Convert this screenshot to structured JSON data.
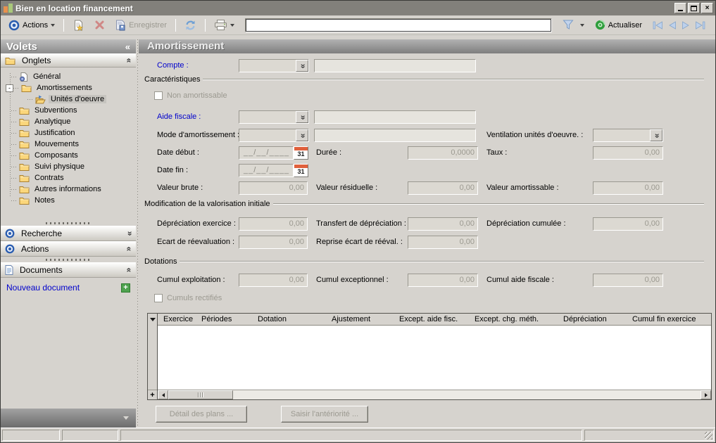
{
  "window": {
    "title": "Bien en location financement"
  },
  "glyphs": {
    "collapse_chevrons": "«",
    "close": "×",
    "plus": "+",
    "table_plus": "+"
  },
  "toolbar": {
    "actions_label": "Actions",
    "save_label": "Enregistrer",
    "refresh_label": "Actualiser",
    "search_value": ""
  },
  "sidebar": {
    "title": "Volets",
    "onglets_header": "Onglets",
    "tree": [
      {
        "label": "Général"
      },
      {
        "label": "Amortissements",
        "expander": "-"
      },
      {
        "label": "Unités d'oeuvre"
      },
      {
        "label": "Subventions"
      },
      {
        "label": "Analytique"
      },
      {
        "label": "Justification"
      },
      {
        "label": "Mouvements"
      },
      {
        "label": "Composants"
      },
      {
        "label": "Suivi physique"
      },
      {
        "label": "Contrats"
      },
      {
        "label": "Autres informations"
      },
      {
        "label": "Notes"
      }
    ],
    "recherche_header": "Recherche",
    "actions_header": "Actions",
    "documents_header": "Documents",
    "new_document_label": "Nouveau document"
  },
  "main": {
    "title": "Amortissement",
    "groups": {
      "caracteristiques": "Caractéristiques",
      "modification": "Modification de la valorisation initiale",
      "dotations": "Dotations"
    },
    "fields": {
      "compte": {
        "label": "Compte :",
        "value": ""
      },
      "non_amortissable": {
        "label": "Non amortissable"
      },
      "aide_fiscale": {
        "label": "Aide fiscale :",
        "value": ""
      },
      "mode_amortissement": {
        "label": "Mode d'amortissement :",
        "value": ""
      },
      "ventilation": {
        "label": "Ventilation unités d'oeuvre. :",
        "value": ""
      },
      "date_debut": {
        "label": "Date début :",
        "mask": "__/__/____",
        "calendar_day": "31"
      },
      "duree": {
        "label": "Durée :",
        "value": "0,0000"
      },
      "taux": {
        "label": "Taux :",
        "value": "0,00"
      },
      "date_fin": {
        "label": "Date fin :",
        "mask": "__/__/____",
        "calendar_day": "31"
      },
      "valeur_brute": {
        "label": "Valeur brute :",
        "value": "0,00"
      },
      "valeur_residuelle": {
        "label": "Valeur résiduelle :",
        "value": "0,00"
      },
      "valeur_amortissable": {
        "label": "Valeur amortissable :",
        "value": "0,00"
      },
      "depreciation_exercice": {
        "label": "Dépréciation exercice :",
        "value": "0,00"
      },
      "transfert_depreciation": {
        "label": "Transfert de dépréciation :",
        "value": "0,00"
      },
      "depreciation_cumulee": {
        "label": "Dépréciation cumulée :",
        "value": "0,00"
      },
      "ecart_reevaluation": {
        "label": "Ecart de réevaluation :",
        "value": "0,00"
      },
      "reprise_ecart": {
        "label": "Reprise écart de rééval. :",
        "value": "0,00"
      },
      "cumul_exploitation": {
        "label": "Cumul exploitation :",
        "value": "0,00"
      },
      "cumul_exceptionnel": {
        "label": "Cumul exceptionnel :",
        "value": "0,00"
      },
      "cumul_aide_fiscale": {
        "label": "Cumul aide fiscale :",
        "value": "0,00"
      },
      "cumuls_rectifies": {
        "label": "Cumuls rectifiés"
      }
    },
    "table": {
      "columns": [
        "Exercice",
        "Périodes",
        "Dotation",
        "Ajustement",
        "Except. aide fisc.",
        "Except. chg. méth.",
        "Dépréciation",
        "Cumul fin exercice"
      ]
    },
    "buttons": {
      "detail_plans": "Détail des plans ...",
      "saisir_anteriorite": "Saisir l'antériorité ..."
    }
  },
  "colors": {
    "accent_blue_label": "#0000cc",
    "window_bg": "#d6d3ce",
    "titlebar": "#82807b",
    "header_gradient_top": "#b2b2b2",
    "header_gradient_bottom": "#7e7e7e",
    "calendar_red": "#e0603c",
    "new_doc_green": "#4fa24f"
  }
}
